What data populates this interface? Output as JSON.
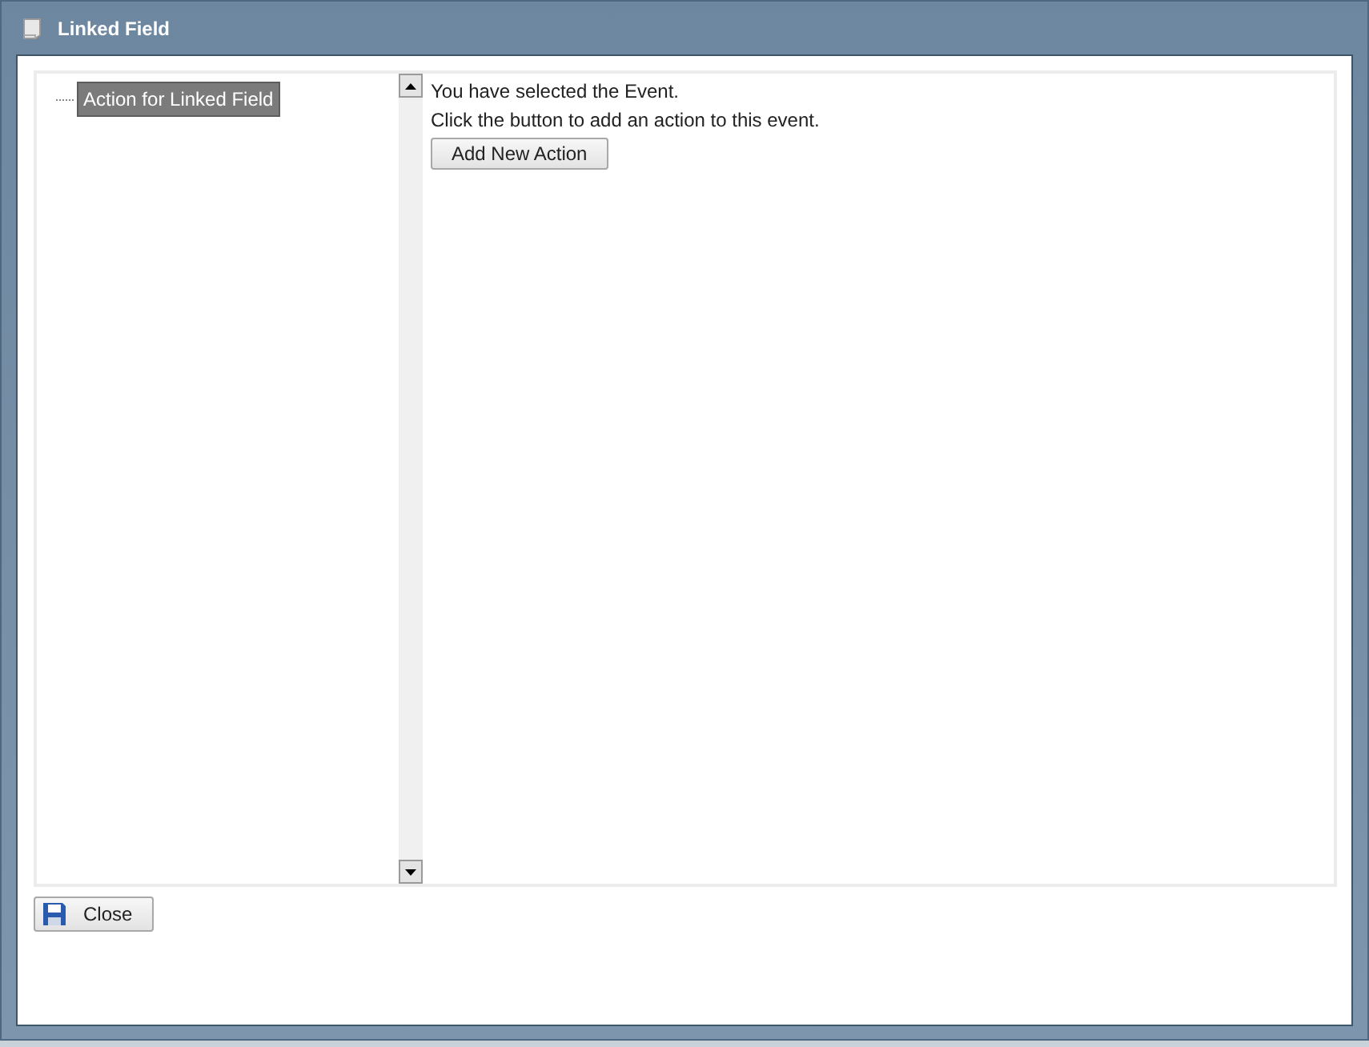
{
  "window": {
    "title": "Linked Field"
  },
  "tree": {
    "items": [
      {
        "label": "Action for Linked Field",
        "selected": true
      }
    ]
  },
  "content": {
    "messages": [
      "You have selected the Event.",
      "Click the button to add an action to this event."
    ],
    "button": "Add New Action"
  },
  "footer": {
    "close_button": "Close"
  }
}
